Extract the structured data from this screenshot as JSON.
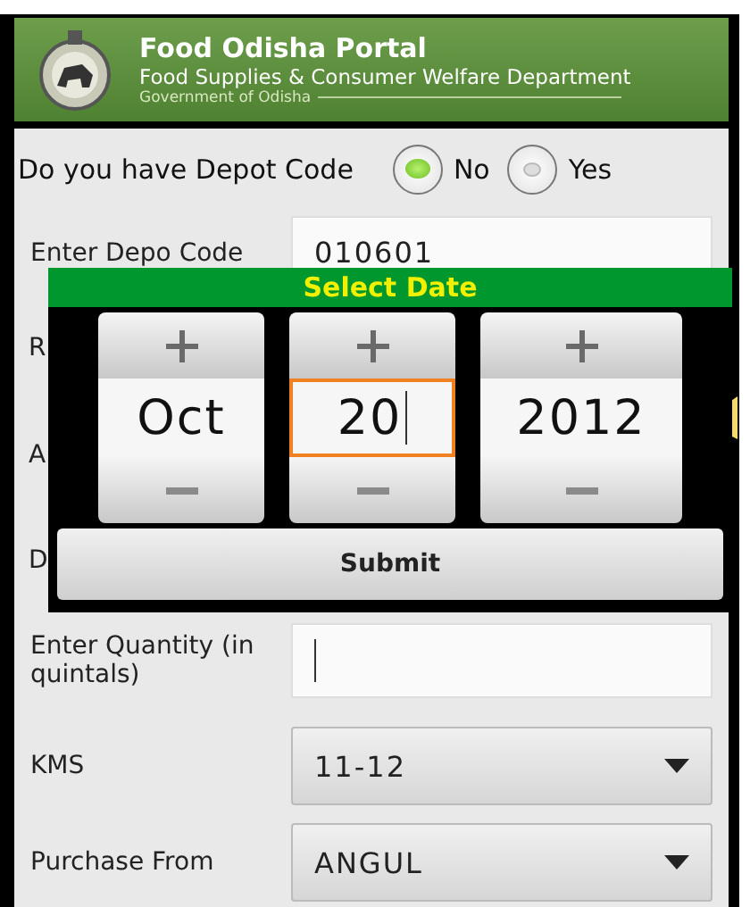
{
  "header": {
    "title": "Food Odisha Portal",
    "subtitle": "Food Supplies & Consumer Welfare Department",
    "government": "Government of Odisha"
  },
  "depot_question": {
    "label": "Do you have Depot Code",
    "options": [
      {
        "label": "No",
        "selected": true
      },
      {
        "label": "Yes",
        "selected": false
      }
    ]
  },
  "fields": [
    {
      "kind": "text",
      "label": "Enter Depo Code",
      "value": "010601"
    },
    {
      "kind": "covered",
      "label": "R"
    },
    {
      "kind": "covered",
      "label": "A"
    },
    {
      "kind": "covered",
      "label": "D"
    },
    {
      "kind": "text",
      "label": "Enter Quantity (in quintals)",
      "focused": true
    },
    {
      "kind": "select",
      "label": "KMS",
      "value": "11-12"
    },
    {
      "kind": "select",
      "label": "Purchase From",
      "value": "ANGUL"
    }
  ],
  "date_dialog": {
    "title": "Select Date",
    "columns": [
      {
        "value": "Oct",
        "focused": false
      },
      {
        "value": "20",
        "focused": true
      },
      {
        "value": "2012",
        "focused": false
      }
    ],
    "submit": "Submit"
  }
}
